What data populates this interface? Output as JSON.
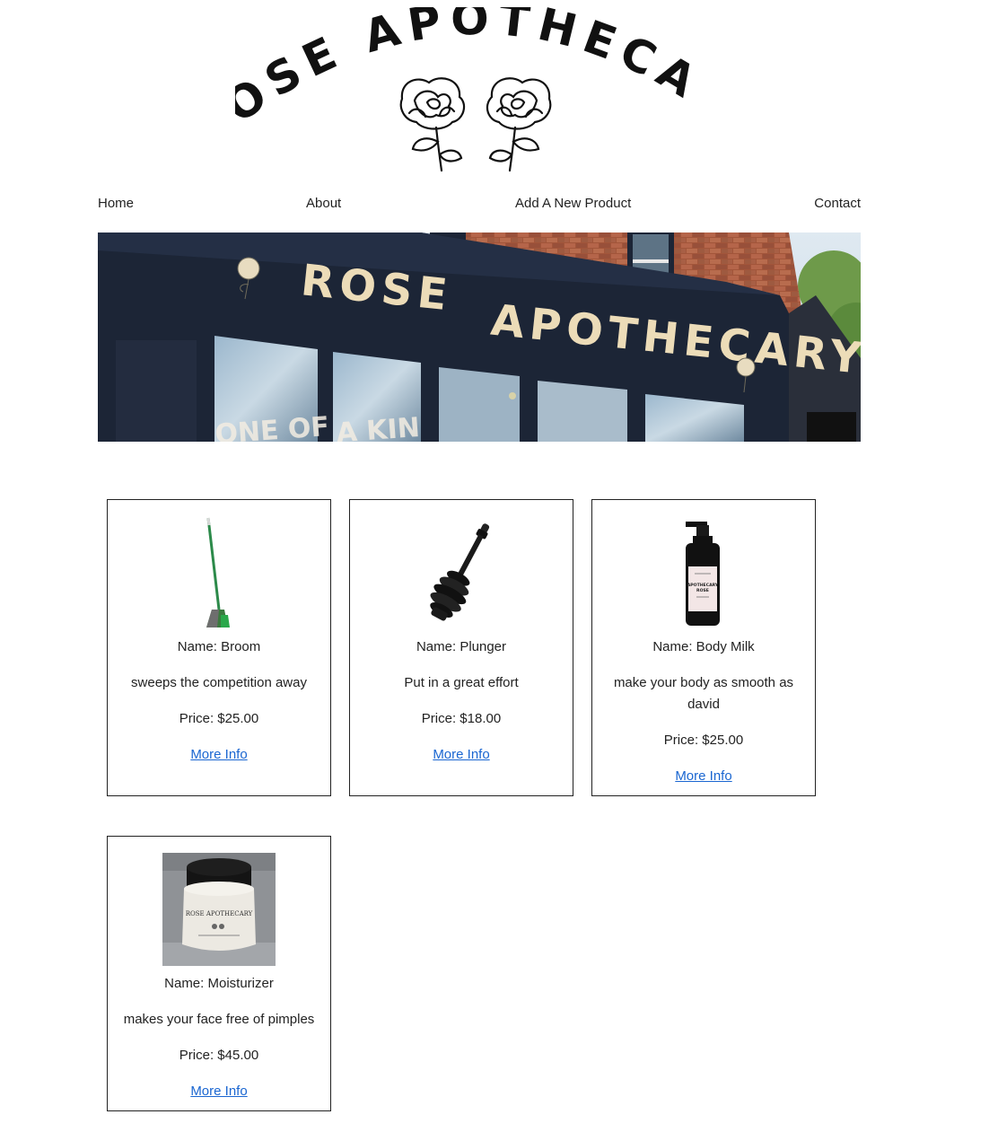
{
  "logo": {
    "line1": "ROSE",
    "line2": "APOTHECARY",
    "icon": "twin-roses-icon"
  },
  "nav": {
    "home": "Home",
    "about": "About",
    "add_product": "Add A New Product",
    "contact": "Contact"
  },
  "hero": {
    "sign_word1": "ROSE",
    "sign_word2": "APOTHECARY",
    "window_text1": "ONE OF",
    "window_text2": "A KIN"
  },
  "colors": {
    "link": "#1a66d1",
    "text": "#222222",
    "storefront": "#1c2536"
  },
  "products": [
    {
      "name_text": "Name: Broom",
      "description": "sweeps the competition away",
      "price_text": "Price: $25.00",
      "link_text": "More Info",
      "icon": "broom-image"
    },
    {
      "name_text": "Name: Plunger",
      "description": "Put in a great effort",
      "price_text": "Price: $18.00",
      "link_text": "More Info",
      "icon": "plunger-image"
    },
    {
      "name_text": "Name: Body Milk",
      "description": "make your body as smooth as david",
      "price_text": "Price: $25.00",
      "link_text": "More Info",
      "icon": "body-milk-bottle-image",
      "bottle_label_line1": "APOTHECARY",
      "bottle_label_line2": "ROSE"
    },
    {
      "name_text": "Name: Moisturizer",
      "description": "makes your face free of pimples",
      "price_text": "Price: $45.00",
      "link_text": "More Info",
      "icon": "moisturizer-jar-image",
      "jar_label_line1": "ROSE APOTHECARY"
    }
  ]
}
